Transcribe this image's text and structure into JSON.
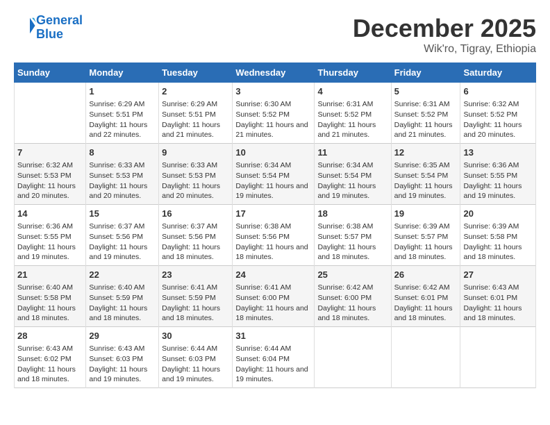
{
  "header": {
    "logo_line1": "General",
    "logo_line2": "Blue",
    "month": "December 2025",
    "location": "Wik'ro, Tigray, Ethiopia"
  },
  "days_of_week": [
    "Sunday",
    "Monday",
    "Tuesday",
    "Wednesday",
    "Thursday",
    "Friday",
    "Saturday"
  ],
  "weeks": [
    [
      {
        "day": "",
        "content": ""
      },
      {
        "day": "1",
        "content": "Sunrise: 6:29 AM\nSunset: 5:51 PM\nDaylight: 11 hours and 22 minutes."
      },
      {
        "day": "2",
        "content": "Sunrise: 6:29 AM\nSunset: 5:51 PM\nDaylight: 11 hours and 21 minutes."
      },
      {
        "day": "3",
        "content": "Sunrise: 6:30 AM\nSunset: 5:52 PM\nDaylight: 11 hours and 21 minutes."
      },
      {
        "day": "4",
        "content": "Sunrise: 6:31 AM\nSunset: 5:52 PM\nDaylight: 11 hours and 21 minutes."
      },
      {
        "day": "5",
        "content": "Sunrise: 6:31 AM\nSunset: 5:52 PM\nDaylight: 11 hours and 21 minutes."
      },
      {
        "day": "6",
        "content": "Sunrise: 6:32 AM\nSunset: 5:52 PM\nDaylight: 11 hours and 20 minutes."
      }
    ],
    [
      {
        "day": "7",
        "content": "Sunrise: 6:32 AM\nSunset: 5:53 PM\nDaylight: 11 hours and 20 minutes."
      },
      {
        "day": "8",
        "content": "Sunrise: 6:33 AM\nSunset: 5:53 PM\nDaylight: 11 hours and 20 minutes."
      },
      {
        "day": "9",
        "content": "Sunrise: 6:33 AM\nSunset: 5:53 PM\nDaylight: 11 hours and 20 minutes."
      },
      {
        "day": "10",
        "content": "Sunrise: 6:34 AM\nSunset: 5:54 PM\nDaylight: 11 hours and 19 minutes."
      },
      {
        "day": "11",
        "content": "Sunrise: 6:34 AM\nSunset: 5:54 PM\nDaylight: 11 hours and 19 minutes."
      },
      {
        "day": "12",
        "content": "Sunrise: 6:35 AM\nSunset: 5:54 PM\nDaylight: 11 hours and 19 minutes."
      },
      {
        "day": "13",
        "content": "Sunrise: 6:36 AM\nSunset: 5:55 PM\nDaylight: 11 hours and 19 minutes."
      }
    ],
    [
      {
        "day": "14",
        "content": "Sunrise: 6:36 AM\nSunset: 5:55 PM\nDaylight: 11 hours and 19 minutes."
      },
      {
        "day": "15",
        "content": "Sunrise: 6:37 AM\nSunset: 5:56 PM\nDaylight: 11 hours and 19 minutes."
      },
      {
        "day": "16",
        "content": "Sunrise: 6:37 AM\nSunset: 5:56 PM\nDaylight: 11 hours and 18 minutes."
      },
      {
        "day": "17",
        "content": "Sunrise: 6:38 AM\nSunset: 5:56 PM\nDaylight: 11 hours and 18 minutes."
      },
      {
        "day": "18",
        "content": "Sunrise: 6:38 AM\nSunset: 5:57 PM\nDaylight: 11 hours and 18 minutes."
      },
      {
        "day": "19",
        "content": "Sunrise: 6:39 AM\nSunset: 5:57 PM\nDaylight: 11 hours and 18 minutes."
      },
      {
        "day": "20",
        "content": "Sunrise: 6:39 AM\nSunset: 5:58 PM\nDaylight: 11 hours and 18 minutes."
      }
    ],
    [
      {
        "day": "21",
        "content": "Sunrise: 6:40 AM\nSunset: 5:58 PM\nDaylight: 11 hours and 18 minutes."
      },
      {
        "day": "22",
        "content": "Sunrise: 6:40 AM\nSunset: 5:59 PM\nDaylight: 11 hours and 18 minutes."
      },
      {
        "day": "23",
        "content": "Sunrise: 6:41 AM\nSunset: 5:59 PM\nDaylight: 11 hours and 18 minutes."
      },
      {
        "day": "24",
        "content": "Sunrise: 6:41 AM\nSunset: 6:00 PM\nDaylight: 11 hours and 18 minutes."
      },
      {
        "day": "25",
        "content": "Sunrise: 6:42 AM\nSunset: 6:00 PM\nDaylight: 11 hours and 18 minutes."
      },
      {
        "day": "26",
        "content": "Sunrise: 6:42 AM\nSunset: 6:01 PM\nDaylight: 11 hours and 18 minutes."
      },
      {
        "day": "27",
        "content": "Sunrise: 6:43 AM\nSunset: 6:01 PM\nDaylight: 11 hours and 18 minutes."
      }
    ],
    [
      {
        "day": "28",
        "content": "Sunrise: 6:43 AM\nSunset: 6:02 PM\nDaylight: 11 hours and 18 minutes."
      },
      {
        "day": "29",
        "content": "Sunrise: 6:43 AM\nSunset: 6:03 PM\nDaylight: 11 hours and 19 minutes."
      },
      {
        "day": "30",
        "content": "Sunrise: 6:44 AM\nSunset: 6:03 PM\nDaylight: 11 hours and 19 minutes."
      },
      {
        "day": "31",
        "content": "Sunrise: 6:44 AM\nSunset: 6:04 PM\nDaylight: 11 hours and 19 minutes."
      },
      {
        "day": "",
        "content": ""
      },
      {
        "day": "",
        "content": ""
      },
      {
        "day": "",
        "content": ""
      }
    ]
  ]
}
